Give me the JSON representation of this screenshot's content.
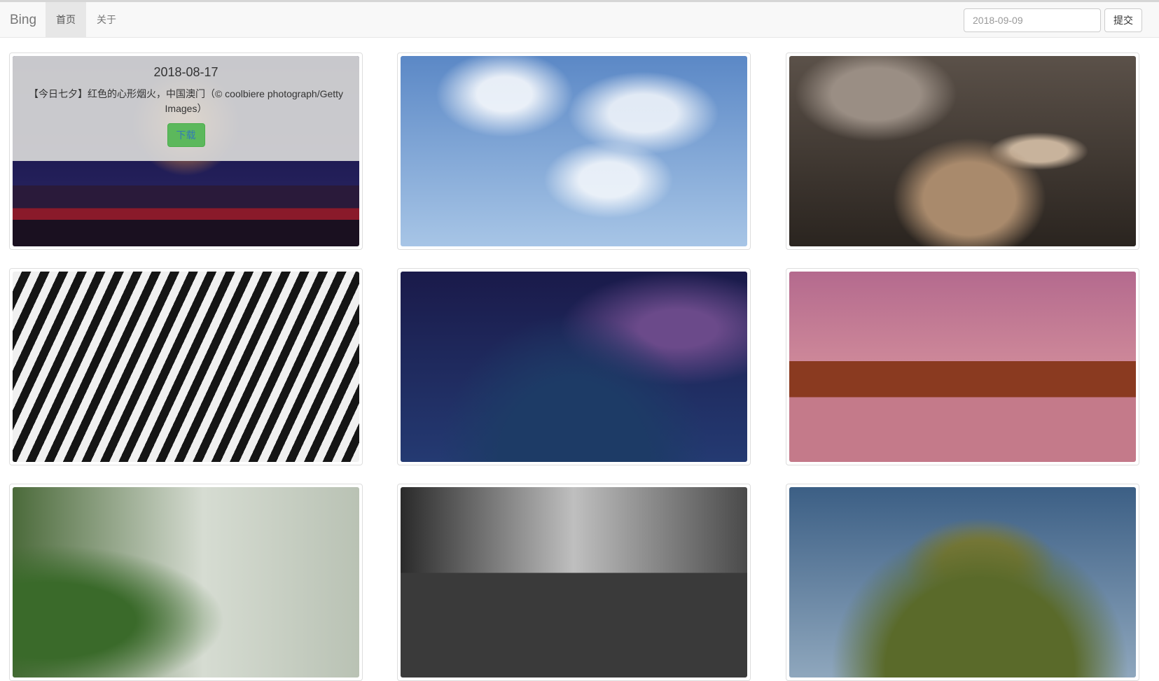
{
  "navbar": {
    "brand": "Bing",
    "home": "首页",
    "about": "关于",
    "date_value": "2018-09-09",
    "submit_label": "提交"
  },
  "cards": [
    {
      "name": "macau-fireworks",
      "date": "2018-08-17",
      "description": "【今日七夕】红色的心形烟火，中国澳门（© coolbiere photograph/Getty Images）",
      "download_label": "下载"
    },
    {
      "name": "roller-coaster"
    },
    {
      "name": "otter"
    },
    {
      "name": "zebra"
    },
    {
      "name": "milky-way"
    },
    {
      "name": "elephants"
    },
    {
      "name": "misty-forest"
    },
    {
      "name": "fossil-museum"
    },
    {
      "name": "mountain-ruins"
    }
  ]
}
